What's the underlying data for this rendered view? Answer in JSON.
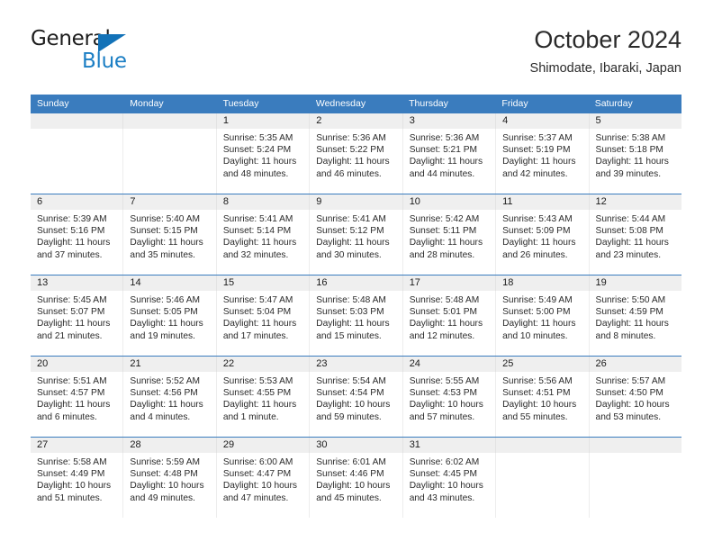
{
  "brand": {
    "name_top": "General",
    "name_bottom": "Blue",
    "triangle_color": "#1272b8",
    "blue_color": "#1b7ec4"
  },
  "header": {
    "title": "October 2024",
    "subtitle": "Shimodate, Ibaraki, Japan",
    "header_bg": "#3a7cbe",
    "date_band_bg": "#efefef"
  },
  "weekdays": [
    "Sunday",
    "Monday",
    "Tuesday",
    "Wednesday",
    "Thursday",
    "Friday",
    "Saturday"
  ],
  "weeks": [
    {
      "days": [
        {
          "date": "",
          "sunrise": "",
          "sunset": "",
          "daylight": ""
        },
        {
          "date": "",
          "sunrise": "",
          "sunset": "",
          "daylight": ""
        },
        {
          "date": "1",
          "sunrise": "Sunrise: 5:35 AM",
          "sunset": "Sunset: 5:24 PM",
          "daylight": "Daylight: 11 hours and 48 minutes."
        },
        {
          "date": "2",
          "sunrise": "Sunrise: 5:36 AM",
          "sunset": "Sunset: 5:22 PM",
          "daylight": "Daylight: 11 hours and 46 minutes."
        },
        {
          "date": "3",
          "sunrise": "Sunrise: 5:36 AM",
          "sunset": "Sunset: 5:21 PM",
          "daylight": "Daylight: 11 hours and 44 minutes."
        },
        {
          "date": "4",
          "sunrise": "Sunrise: 5:37 AM",
          "sunset": "Sunset: 5:19 PM",
          "daylight": "Daylight: 11 hours and 42 minutes."
        },
        {
          "date": "5",
          "sunrise": "Sunrise: 5:38 AM",
          "sunset": "Sunset: 5:18 PM",
          "daylight": "Daylight: 11 hours and 39 minutes."
        }
      ]
    },
    {
      "days": [
        {
          "date": "6",
          "sunrise": "Sunrise: 5:39 AM",
          "sunset": "Sunset: 5:16 PM",
          "daylight": "Daylight: 11 hours and 37 minutes."
        },
        {
          "date": "7",
          "sunrise": "Sunrise: 5:40 AM",
          "sunset": "Sunset: 5:15 PM",
          "daylight": "Daylight: 11 hours and 35 minutes."
        },
        {
          "date": "8",
          "sunrise": "Sunrise: 5:41 AM",
          "sunset": "Sunset: 5:14 PM",
          "daylight": "Daylight: 11 hours and 32 minutes."
        },
        {
          "date": "9",
          "sunrise": "Sunrise: 5:41 AM",
          "sunset": "Sunset: 5:12 PM",
          "daylight": "Daylight: 11 hours and 30 minutes."
        },
        {
          "date": "10",
          "sunrise": "Sunrise: 5:42 AM",
          "sunset": "Sunset: 5:11 PM",
          "daylight": "Daylight: 11 hours and 28 minutes."
        },
        {
          "date": "11",
          "sunrise": "Sunrise: 5:43 AM",
          "sunset": "Sunset: 5:09 PM",
          "daylight": "Daylight: 11 hours and 26 minutes."
        },
        {
          "date": "12",
          "sunrise": "Sunrise: 5:44 AM",
          "sunset": "Sunset: 5:08 PM",
          "daylight": "Daylight: 11 hours and 23 minutes."
        }
      ]
    },
    {
      "days": [
        {
          "date": "13",
          "sunrise": "Sunrise: 5:45 AM",
          "sunset": "Sunset: 5:07 PM",
          "daylight": "Daylight: 11 hours and 21 minutes."
        },
        {
          "date": "14",
          "sunrise": "Sunrise: 5:46 AM",
          "sunset": "Sunset: 5:05 PM",
          "daylight": "Daylight: 11 hours and 19 minutes."
        },
        {
          "date": "15",
          "sunrise": "Sunrise: 5:47 AM",
          "sunset": "Sunset: 5:04 PM",
          "daylight": "Daylight: 11 hours and 17 minutes."
        },
        {
          "date": "16",
          "sunrise": "Sunrise: 5:48 AM",
          "sunset": "Sunset: 5:03 PM",
          "daylight": "Daylight: 11 hours and 15 minutes."
        },
        {
          "date": "17",
          "sunrise": "Sunrise: 5:48 AM",
          "sunset": "Sunset: 5:01 PM",
          "daylight": "Daylight: 11 hours and 12 minutes."
        },
        {
          "date": "18",
          "sunrise": "Sunrise: 5:49 AM",
          "sunset": "Sunset: 5:00 PM",
          "daylight": "Daylight: 11 hours and 10 minutes."
        },
        {
          "date": "19",
          "sunrise": "Sunrise: 5:50 AM",
          "sunset": "Sunset: 4:59 PM",
          "daylight": "Daylight: 11 hours and 8 minutes."
        }
      ]
    },
    {
      "days": [
        {
          "date": "20",
          "sunrise": "Sunrise: 5:51 AM",
          "sunset": "Sunset: 4:57 PM",
          "daylight": "Daylight: 11 hours and 6 minutes."
        },
        {
          "date": "21",
          "sunrise": "Sunrise: 5:52 AM",
          "sunset": "Sunset: 4:56 PM",
          "daylight": "Daylight: 11 hours and 4 minutes."
        },
        {
          "date": "22",
          "sunrise": "Sunrise: 5:53 AM",
          "sunset": "Sunset: 4:55 PM",
          "daylight": "Daylight: 11 hours and 1 minute."
        },
        {
          "date": "23",
          "sunrise": "Sunrise: 5:54 AM",
          "sunset": "Sunset: 4:54 PM",
          "daylight": "Daylight: 10 hours and 59 minutes."
        },
        {
          "date": "24",
          "sunrise": "Sunrise: 5:55 AM",
          "sunset": "Sunset: 4:53 PM",
          "daylight": "Daylight: 10 hours and 57 minutes."
        },
        {
          "date": "25",
          "sunrise": "Sunrise: 5:56 AM",
          "sunset": "Sunset: 4:51 PM",
          "daylight": "Daylight: 10 hours and 55 minutes."
        },
        {
          "date": "26",
          "sunrise": "Sunrise: 5:57 AM",
          "sunset": "Sunset: 4:50 PM",
          "daylight": "Daylight: 10 hours and 53 minutes."
        }
      ]
    },
    {
      "days": [
        {
          "date": "27",
          "sunrise": "Sunrise: 5:58 AM",
          "sunset": "Sunset: 4:49 PM",
          "daylight": "Daylight: 10 hours and 51 minutes."
        },
        {
          "date": "28",
          "sunrise": "Sunrise: 5:59 AM",
          "sunset": "Sunset: 4:48 PM",
          "daylight": "Daylight: 10 hours and 49 minutes."
        },
        {
          "date": "29",
          "sunrise": "Sunrise: 6:00 AM",
          "sunset": "Sunset: 4:47 PM",
          "daylight": "Daylight: 10 hours and 47 minutes."
        },
        {
          "date": "30",
          "sunrise": "Sunrise: 6:01 AM",
          "sunset": "Sunset: 4:46 PM",
          "daylight": "Daylight: 10 hours and 45 minutes."
        },
        {
          "date": "31",
          "sunrise": "Sunrise: 6:02 AM",
          "sunset": "Sunset: 4:45 PM",
          "daylight": "Daylight: 10 hours and 43 minutes."
        },
        {
          "date": "",
          "sunrise": "",
          "sunset": "",
          "daylight": ""
        },
        {
          "date": "",
          "sunrise": "",
          "sunset": "",
          "daylight": ""
        }
      ]
    }
  ]
}
